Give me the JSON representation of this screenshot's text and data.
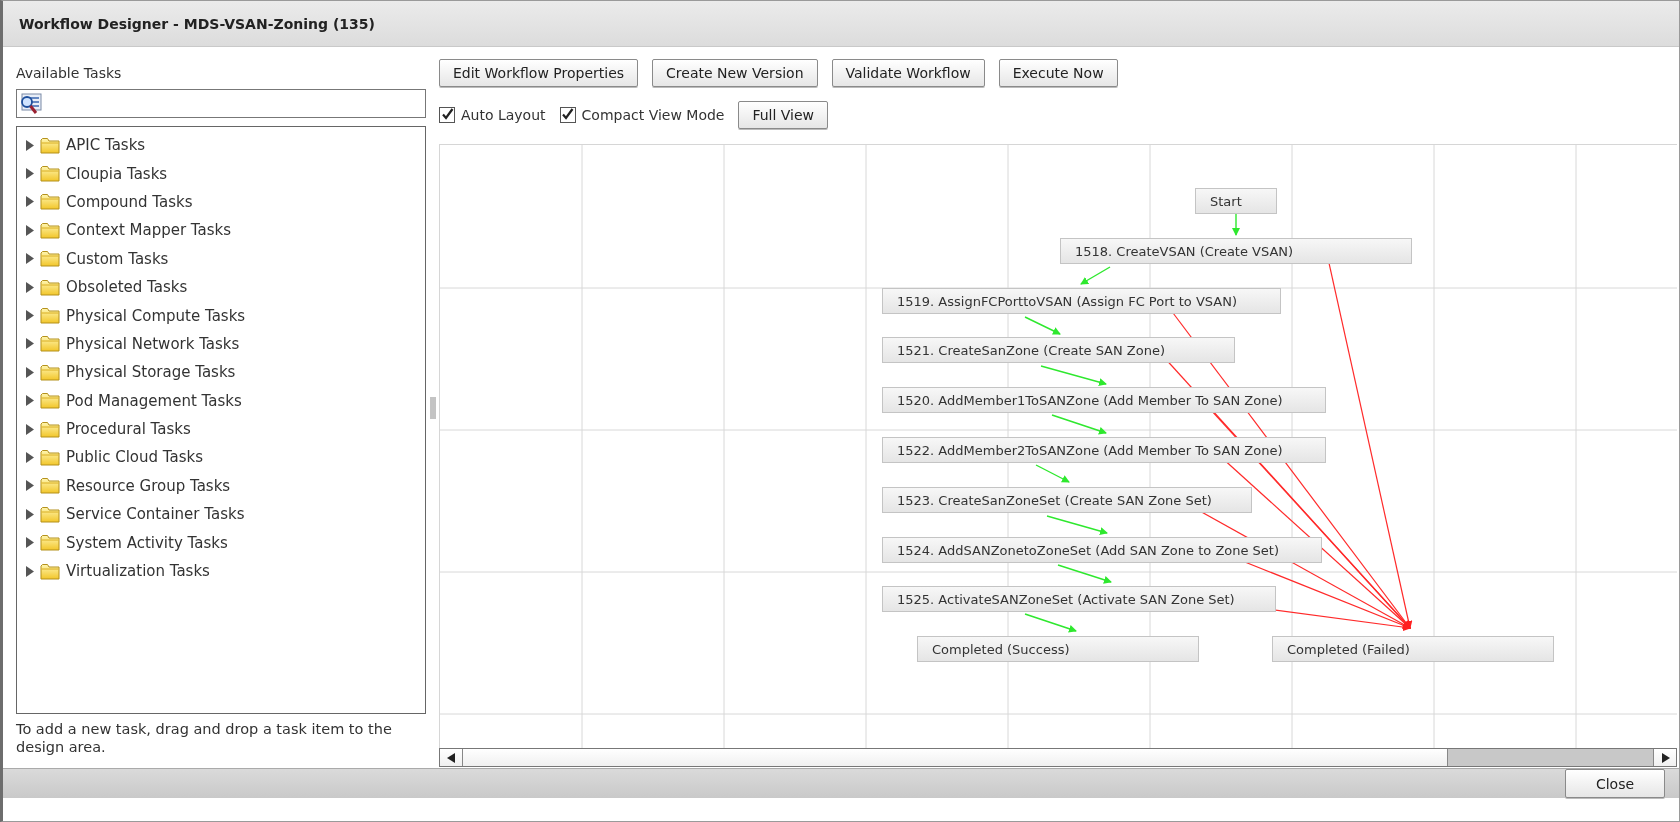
{
  "window": {
    "title": "Workflow Designer - MDS-VSAN-Zoning (135)"
  },
  "sidebar": {
    "heading": "Available Tasks",
    "tree": [
      {
        "label": "APIC Tasks",
        "expanded": false
      },
      {
        "label": "Cloupia Tasks",
        "expanded": false
      },
      {
        "label": "Compound Tasks",
        "expanded": false
      },
      {
        "label": "Context Mapper Tasks",
        "expanded": false
      },
      {
        "label": "Custom Tasks",
        "expanded": false
      },
      {
        "label": "Obsoleted Tasks",
        "expanded": false
      },
      {
        "label": "Physical Compute Tasks",
        "expanded": false
      },
      {
        "label": "Physical Network Tasks",
        "expanded": false
      },
      {
        "label": "Physical Storage Tasks",
        "expanded": false
      },
      {
        "label": "Pod Management Tasks",
        "expanded": false
      },
      {
        "label": "Procedural Tasks",
        "expanded": false
      },
      {
        "label": "Public Cloud Tasks",
        "expanded": false
      },
      {
        "label": "Resource Group Tasks",
        "expanded": false
      },
      {
        "label": "Service Container Tasks",
        "expanded": false
      },
      {
        "label": "System Activity Tasks",
        "expanded": false
      },
      {
        "label": "Virtualization Tasks",
        "expanded": false
      }
    ],
    "hint": "To add a new task, drag and drop a task item to the design area."
  },
  "toolbar": {
    "buttons": [
      "Edit Workflow Properties",
      "Create New Version",
      "Validate Workflow",
      "Execute Now"
    ],
    "options": [
      {
        "label": "Auto Layout",
        "checked": true
      },
      {
        "label": "Compact View Mode",
        "checked": true
      }
    ],
    "view_button": "Full View"
  },
  "diagram": {
    "nodes": [
      {
        "kind": "start",
        "label": "Start"
      },
      {
        "kind": "task",
        "label": "1518. CreateVSAN (Create VSAN)"
      },
      {
        "kind": "task",
        "label": "1519. AssignFCPorttoVSAN (Assign FC Port to VSAN)"
      },
      {
        "kind": "task",
        "label": "1521. CreateSanZone (Create SAN Zone)"
      },
      {
        "kind": "task",
        "label": "1520. AddMember1ToSANZone (Add Member To SAN Zone)"
      },
      {
        "kind": "task",
        "label": "1522. AddMember2ToSANZone (Add Member To SAN Zone)"
      },
      {
        "kind": "task",
        "label": "1523. CreateSanZoneSet (Create SAN Zone Set)"
      },
      {
        "kind": "task",
        "label": "1524. AddSANZonetoZoneSet (Add SAN Zone to Zone Set)"
      },
      {
        "kind": "task",
        "label": "1525. ActivateSANZoneSet (Activate SAN Zone Set)"
      },
      {
        "kind": "success",
        "label": "Completed (Success)"
      },
      {
        "kind": "failure",
        "label": "Completed (Failed)"
      }
    ]
  },
  "footer": {
    "buttons": [
      "Close"
    ]
  }
}
